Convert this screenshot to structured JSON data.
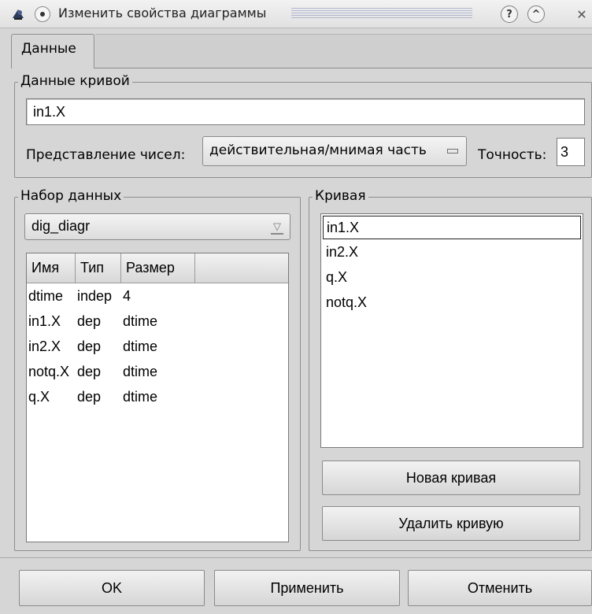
{
  "window": {
    "title": "Изменить свойства диаграммы",
    "help_glyph": "?",
    "max_glyph": "^",
    "close_glyph": "✕"
  },
  "tabs": [
    {
      "label": "Данные",
      "active": true
    }
  ],
  "curve_data": {
    "group_title": "Данные кривой",
    "expression_value": "in1.X",
    "number_repr_label": "Представление чисел:",
    "number_repr_value": "действительная/мнимая часть",
    "precision_label": "Точность:",
    "precision_value": "3"
  },
  "dataset": {
    "group_title": "Набор данных",
    "selected": "dig_diagr",
    "columns": [
      "Имя",
      "Тип",
      "Размер",
      ""
    ],
    "rows": [
      {
        "name": "dtime",
        "type": "indep",
        "size": "4"
      },
      {
        "name": "in1.X",
        "type": "dep",
        "size": "dtime"
      },
      {
        "name": "in2.X",
        "type": "dep",
        "size": "dtime"
      },
      {
        "name": "notq.X",
        "type": "dep",
        "size": "dtime"
      },
      {
        "name": "q.X",
        "type": "dep",
        "size": "dtime"
      }
    ]
  },
  "curve": {
    "group_title": "Кривая",
    "items": [
      "in1.X",
      "in2.X",
      "q.X",
      "notq.X"
    ],
    "selected_index": 0,
    "new_button": "Новая кривая",
    "delete_button": "Удалить кривую"
  },
  "footer": {
    "ok": "OK",
    "apply": "Применить",
    "cancel": "Отменить"
  },
  "colors": {
    "window_bg": "#d6d6d6",
    "field_bg": "#ffffff",
    "border": "#8e8e8e"
  }
}
